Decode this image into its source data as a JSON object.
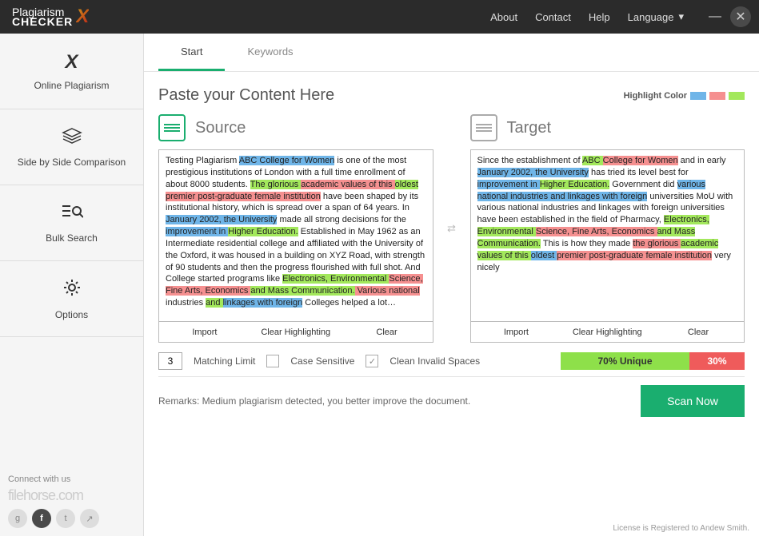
{
  "header": {
    "brand_top": "Plagiarism",
    "brand_bot": "CHECKER",
    "nav": {
      "about": "About",
      "contact": "Contact",
      "help": "Help",
      "language": "Language"
    }
  },
  "sidebar": {
    "items": [
      {
        "label": "Online Plagiarism"
      },
      {
        "label": "Side by Side Comparison"
      },
      {
        "label": "Bulk Search"
      },
      {
        "label": "Options"
      }
    ],
    "connect": "Connect with us",
    "watermark": "filehorse.com"
  },
  "tabs": {
    "start": "Start",
    "keywords": "Keywords"
  },
  "heading": "Paste your Content Here",
  "highlight_label": "Highlight Color",
  "panel_titles": {
    "source": "Source",
    "target": "Target"
  },
  "actions": {
    "import": "Import",
    "clear_hl": "Clear Highlighting",
    "clear": "Clear"
  },
  "options": {
    "matching_limit_value": "3",
    "matching_limit": "Matching Limit",
    "case_sensitive": "Case Sensitive",
    "clean_invalid": "Clean Invalid Spaces"
  },
  "bars": {
    "unique": "70% Unique",
    "plagiarized": "30%"
  },
  "remarks": "Remarks: Medium plagiarism detected, you better improve the document.",
  "scan": "Scan Now",
  "license": "License is Registered to Andew Smith.",
  "source_text": {
    "p1a": "Testing Plagiarism ",
    "p1b": "ABC College for Women",
    "p1c": " is one of the most prestigious institutions of London with a full time enrollment of about 8000 students. ",
    "p1d": "The glorious ",
    "p1e": "academic values of this ",
    "p1f": "oldest ",
    "p1g": "premier post-graduate female institution",
    "p1h": " have been shaped by its institutional history, which is spread over a span of 64 years. In ",
    "p1i": "January 2002, the University",
    "p1j": " made all strong decisions for the ",
    "p1k": "improvement in ",
    "p1l": "Higher Education.",
    "p1m": " Established in May 1962 as an Intermediate residential college and affiliated with the University of the Oxford, it was housed in a building on XYZ Road, with strength of 90 students and then the progress flourished with full shot. And College started programs like ",
    "p1n": "Electronics, Environmental ",
    "p1o": "Science, Fine Arts, Economics ",
    "p1p": "and Mass Communication.",
    "p1q": " Various national",
    "p1r": " industries ",
    "p1s": "and ",
    "p1t": "linkages with foreign",
    "p1u": " Colleges helped a lot…"
  },
  "target_text": {
    "t1a": "Since the establishment of ",
    "t1b": "ABC ",
    "t1c": "College for Women",
    "t1d": " and in early ",
    "t1e": "January 2002, the University",
    "t1f": " has tried its level best for ",
    "t1g": "improvement in ",
    "t1h": "Higher Education.",
    "t1i": " Government did ",
    "t1j": "various national industries and linkages with foreign",
    "t1k": " universities MoU with various national industries and linkages with foreign universities have been established in the field of Pharmacy, ",
    "t1l": "Electronics, Environmental ",
    "t1m": "Science, Fine Arts, Economics ",
    "t1n": "and Mass Communication.",
    "t1o": " This is how they made ",
    "t1p": "the glorious ",
    "t1q": "academic values of this ",
    "t1r": "oldest ",
    "t1s": "premier post-graduate female institution",
    "t1t": " very nicely"
  }
}
